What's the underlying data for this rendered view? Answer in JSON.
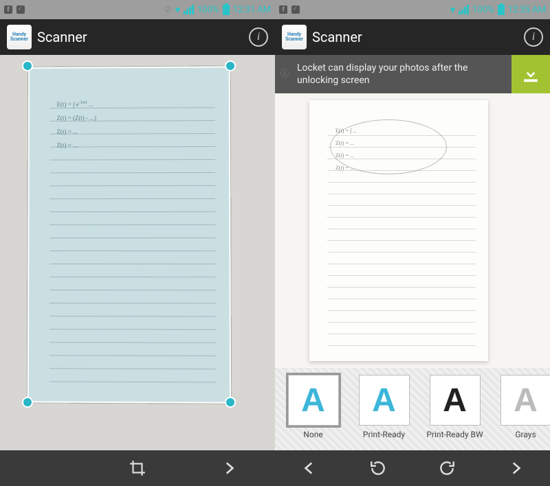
{
  "left": {
    "status": {
      "battery": "100%",
      "time": "12:31 AM"
    },
    "app": {
      "title": "Scanner",
      "icon_text": "Handy\nScanner"
    }
  },
  "right": {
    "status": {
      "battery": "100%",
      "time": "12:35 AM"
    },
    "app": {
      "title": "Scanner",
      "icon_text": "Handy\nScanner"
    },
    "banner": {
      "text": "Locket can display your photos after the unlocking screen"
    },
    "filters": [
      {
        "label": "None",
        "glyph": "A",
        "color": "fc-none",
        "selected": true
      },
      {
        "label": "Print-Ready",
        "glyph": "A",
        "color": "fc-pr",
        "selected": false
      },
      {
        "label": "Print-Ready BW",
        "glyph": "A",
        "color": "fc-bw",
        "selected": false
      },
      {
        "label": "Grays",
        "glyph": "A",
        "color": "fc-gs",
        "selected": false
      }
    ]
  }
}
